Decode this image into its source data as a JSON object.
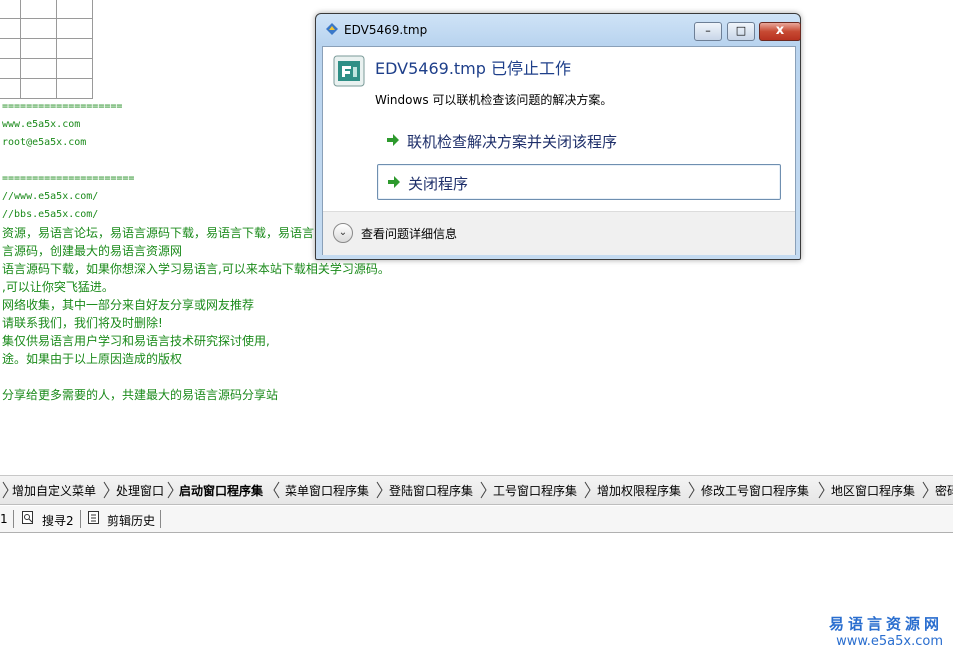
{
  "editor": {
    "lines": [
      "====================",
      "www.e5a5x.com",
      "root@e5a5x.com",
      "======================",
      "//www.e5a5x.com/",
      "//bbs.e5a5x.com/",
      "资源，易语言论坛，易语言源码下载，易语言下载，易语言",
      "言源码，创建最大的易语言资源网",
      "语言源码下载，如果你想深入学习易语言,可以来本站下载相关学习源码。",
      ",可以让你突飞猛进。",
      "网络收集，其中一部分来自好友分享或网友推荐",
      "请联系我们，我们将及时删除!",
      "集仅供易语言用户学习和易语言技术研究探讨使用,",
      "途。如果由于以上原因造成的版权",
      "分享给更多需要的人，共建最大的易语言源码分享站"
    ]
  },
  "tabs": [
    {
      "label": "增加自定义菜单",
      "active": false
    },
    {
      "label": "处理窗口",
      "active": false
    },
    {
      "label": "启动窗口程序集",
      "active": true
    },
    {
      "label": "菜单窗口程序集",
      "active": false
    },
    {
      "label": "登陆窗口程序集",
      "active": false
    },
    {
      "label": "工号窗口程序集",
      "active": false
    },
    {
      "label": "增加权限程序集",
      "active": false
    },
    {
      "label": "修改工号窗口程序集",
      "active": false
    },
    {
      "label": "地区窗口程序集",
      "active": false
    },
    {
      "label": "密码",
      "active": false
    }
  ],
  "bottom_bar": {
    "item1": "1",
    "search2": "搜寻2",
    "clip_history": "剪辑历史"
  },
  "watermark": {
    "title": "易语言资源网",
    "url": "www.e5a5x.com"
  },
  "dialog": {
    "window_title": "EDV5469.tmp",
    "main_title": "EDV5469.tmp 已停止工作",
    "description": "Windows 可以联机检查该问题的解决方案。",
    "option_check_online": "联机检查解决方案并关闭该程序",
    "option_close": "关闭程序",
    "details": "查看问题详细信息",
    "minimize_glyph": "–",
    "maximize_glyph": "□",
    "close_glyph": "x"
  },
  "colors": {
    "code_text": "#1a8a1a",
    "dialog_title": "#1e3f8a",
    "arrow_green": "#2e9a2e"
  }
}
